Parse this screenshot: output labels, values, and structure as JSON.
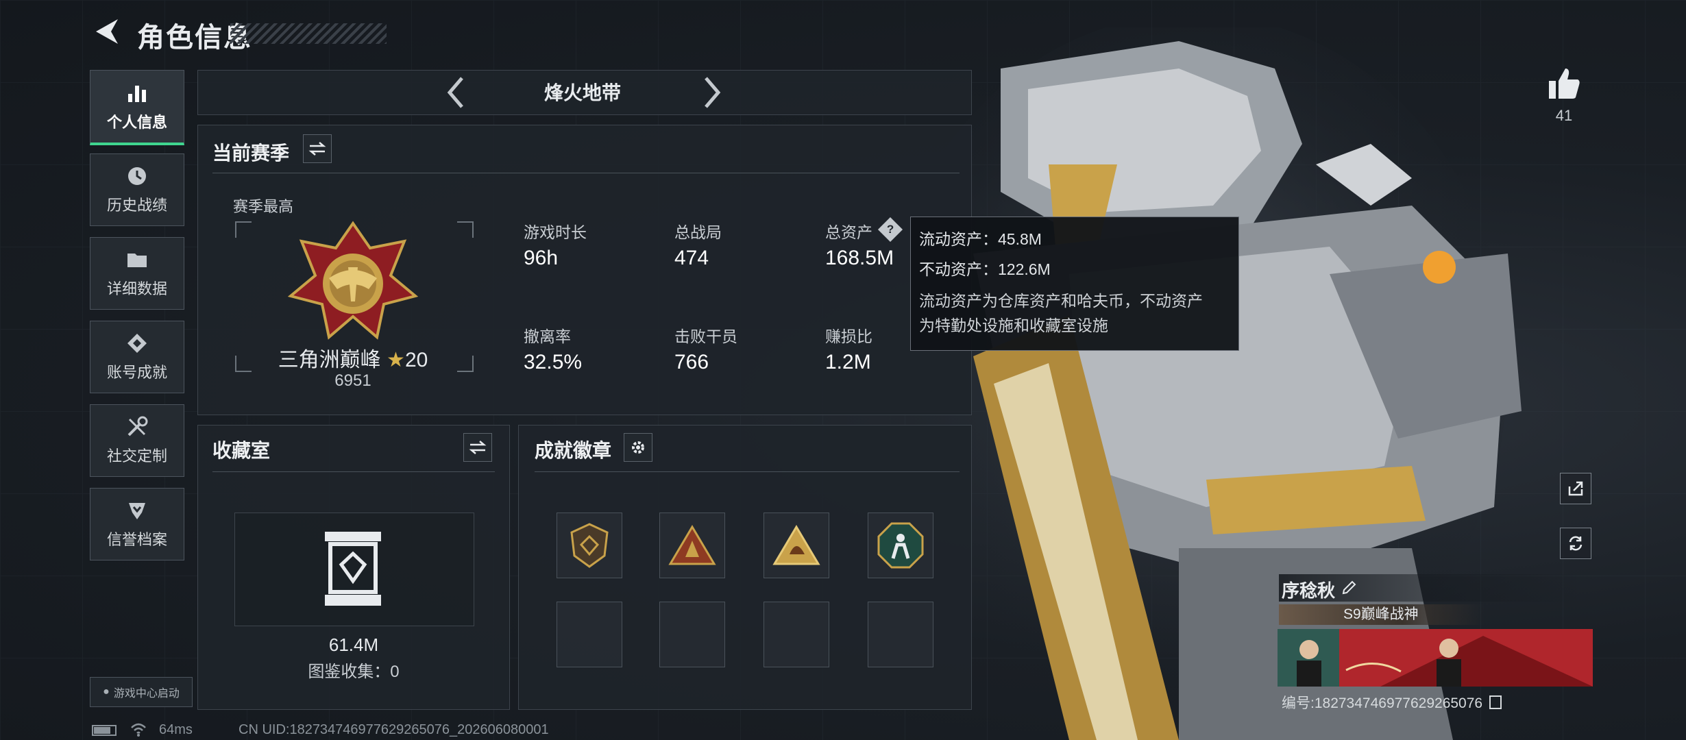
{
  "header": {
    "title": "角色信息"
  },
  "sidebar": {
    "items": [
      {
        "label": "个人信息",
        "icon": "bar-chart-icon",
        "active": true
      },
      {
        "label": "历史战绩",
        "icon": "history-clock-icon",
        "active": false
      },
      {
        "label": "详细数据",
        "icon": "folder-icon",
        "active": false
      },
      {
        "label": "账号成就",
        "icon": "achievement-diamond-icon",
        "active": false
      },
      {
        "label": "社交定制",
        "icon": "wrench-tools-icon",
        "active": false
      },
      {
        "label": "信誉档案",
        "icon": "reputation-shield-icon",
        "active": false
      }
    ],
    "launcher_label": "游戏中心启动"
  },
  "mode_selector": {
    "label": "烽火地带"
  },
  "season": {
    "title": "当前赛季",
    "best_label": "赛季最高",
    "rank_name": "三角洲巅峰",
    "rank_stars": "20",
    "rank_points": "6951",
    "stats": [
      {
        "label": "游戏时长",
        "value": "96h"
      },
      {
        "label": "总战局",
        "value": "474"
      },
      {
        "label": "总资产",
        "value": "168.5M"
      },
      {
        "label": "撤离率",
        "value": "32.5%"
      },
      {
        "label": "击败干员",
        "value": "766"
      },
      {
        "label": "赚损比",
        "value": "1.2M"
      }
    ]
  },
  "tooltip": {
    "liquid": "流动资产：45.8M",
    "fixed": "不动资产：122.6M",
    "desc_line1": "流动资产为仓库资产和哈夫币，不动资产",
    "desc_line2": "为特勤处设施和收藏室设施"
  },
  "collection": {
    "title": "收藏室",
    "value": "61.4M",
    "catalog": "图鉴收集：0"
  },
  "badges": {
    "title": "成就徽章"
  },
  "profile": {
    "likes": "41",
    "name": "序稔秋",
    "title_badge": "S9巅峰战神",
    "id_line": "编号:1827347469776292650​76"
  },
  "status": {
    "ping": "64ms",
    "uid": "CN UID:182734746977629265076_202606080001"
  },
  "colors": {
    "accent_green": "#3fd58f",
    "gold": "#c9a24a",
    "panel": "#1e242a"
  }
}
